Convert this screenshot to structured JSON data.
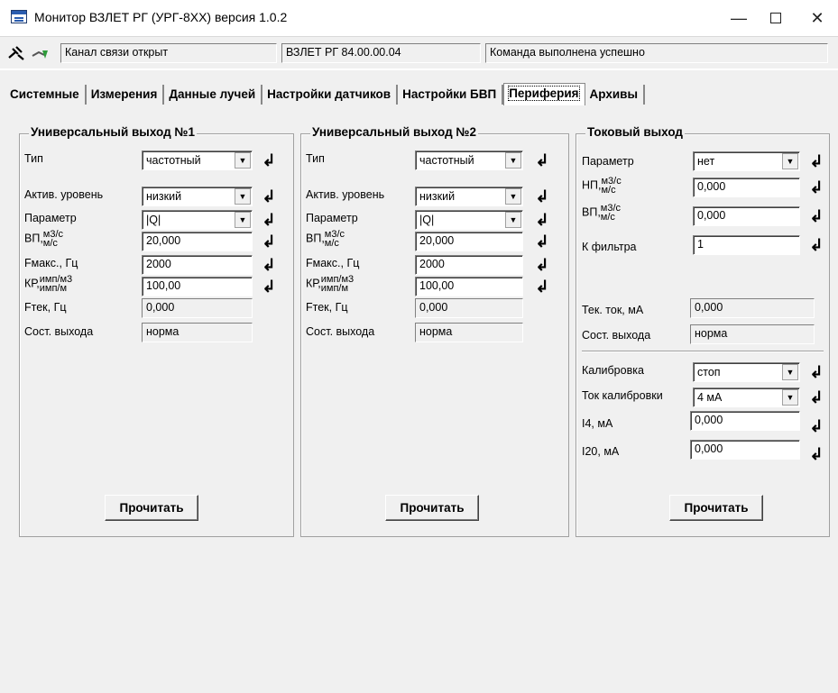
{
  "window": {
    "title": "Монитор ВЗЛЕТ РГ (УРГ-8ХХ) версия 1.0.2",
    "min": "—",
    "close": "✕"
  },
  "toolbar": {
    "disconnect_icon": "plug-icon",
    "connect_icon": "antenna-icon",
    "status_channel": "Канал связи открыт",
    "status_device": "ВЗЛЕТ РГ 84.00.00.04",
    "status_command": "Команда выполнена успешно"
  },
  "tabs": [
    "Системные",
    "Измерения",
    "Данные лучей",
    "Настройки датчиков",
    "Настройки БВП",
    "Периферия",
    "Архивы"
  ],
  "active_tab": "Периферия",
  "enter_glyph": "↲",
  "combo_arrow": "▼",
  "out1": {
    "title": "Универсальный выход №1",
    "type_label": "Тип",
    "type_value": "частотный",
    "level_label": "Актив. уровень",
    "level_value": "низкий",
    "param_label": "Параметр",
    "param_value": "|Q|",
    "vp_label": "ВП,",
    "vp_unit_top": "м3/с",
    "vp_unit_bot": "м/с",
    "vp_value": "20,000",
    "fmax_label": "Fмакс., Гц",
    "fmax_value": "2000",
    "kp_label": "КР,",
    "kp_unit_top": "имп/м3",
    "kp_unit_bot": "имп/м",
    "kp_value": "100,00",
    "ftek_label": "Fтек, Гц",
    "ftek_value": "0,000",
    "state_label": "Сост. выхода",
    "state_value": "норма",
    "read_button": "Прочитать"
  },
  "out2": {
    "title": "Универсальный выход №2",
    "type_label": "Тип",
    "type_value": "частотный",
    "level_label": "Актив. уровень",
    "level_value": "низкий",
    "param_label": "Параметр",
    "param_value": "|Q|",
    "vp_label": "ВП,",
    "vp_unit_top": "м3/с",
    "vp_unit_bot": "м/с",
    "vp_value": "20,000",
    "fmax_label": "Fмакс., Гц",
    "fmax_value": "2000",
    "kp_label": "КР,",
    "kp_unit_top": "имп/м3",
    "kp_unit_bot": "имп/м",
    "kp_value": "100,00",
    "ftek_label": "Fтек, Гц",
    "ftek_value": "0,000",
    "state_label": "Сост. выхода",
    "state_value": "норма",
    "read_button": "Прочитать"
  },
  "current": {
    "title": "Токовый выход",
    "param_label": "Параметр",
    "param_value": "нет",
    "np_label": "НП,",
    "np_unit_top": "м3/с",
    "np_unit_bot": "м/с",
    "np_value": "0,000",
    "vp_label": "ВП,",
    "vp_unit_top": "м3/с",
    "vp_unit_bot": "м/с",
    "vp_value": "0,000",
    "kf_label": "К фильтра",
    "kf_value": "1",
    "tek_label": "Тек. ток, мА",
    "tek_value": "0,000",
    "state_label": "Сост. выхода",
    "state_value": "норма",
    "calib_label": "Калибровка",
    "calib_value": "стоп",
    "calib_current_label": "Ток калибровки",
    "calib_current_value": "4 мА",
    "i4_label": "I4, мА",
    "i4_value": "0,000",
    "i20_label": "I20, мА",
    "i20_value": "0,000",
    "read_button": "Прочитать"
  }
}
